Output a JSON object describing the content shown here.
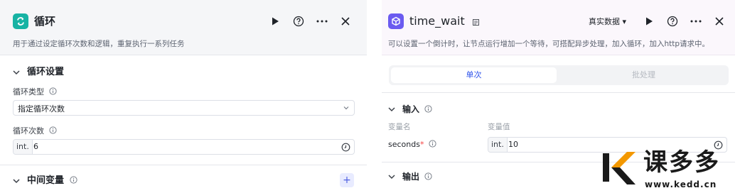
{
  "loop_node": {
    "title": "循环",
    "description": "用于通过设定循环次数和逻辑，重复执行一系列任务",
    "settings": {
      "section_title": "循环设置",
      "loop_type_label": "循环类型",
      "loop_type_value": "指定循环次数",
      "loop_count_label": "循环次数",
      "loop_count_type": "int.",
      "loop_count_value": "6"
    },
    "variables": {
      "section_title": "中间变量",
      "add_label": "+"
    }
  },
  "wait_node": {
    "title": "time_wait",
    "data_source": "真实数据 ▾",
    "description": "可以设置一个倒计时，让节点运行增加一个等待，可搭配异步处理，加入循环，加入http请求中。",
    "tabs": [
      "单次",
      "批处理"
    ],
    "input": {
      "section_title": "输入",
      "col_name": "变量名",
      "col_value": "变量值",
      "var_name": "seconds",
      "required_mark": "*",
      "var_type": "int.",
      "var_value": "10"
    },
    "output": {
      "section_title": "输出"
    }
  },
  "watermark": {
    "brand": "课多多",
    "url": "www.kedd.cn"
  },
  "colors": {
    "loop_accent": "#17b3a4",
    "wait_accent": "#6b5bf0",
    "tab_active": "#2f54eb"
  }
}
